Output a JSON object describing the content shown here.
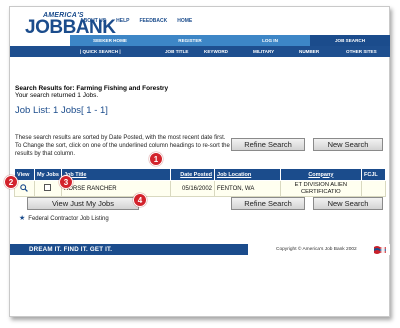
{
  "header": {
    "logo_small": "AMERICA'S",
    "logo_big": "JOBBANK",
    "top_nav": [
      "ABOUT US",
      "HELP",
      "FEEDBACK",
      "HOME"
    ]
  },
  "nav_primary": [
    "SEEKER HOME",
    "REGISTER",
    "LOG IN",
    "JOB SEARCH"
  ],
  "nav_secondary": [
    "| QUICK SEARCH |",
    "JOB TITLE",
    "KEYWORD",
    "MILITARY",
    "NUMBER",
    "OTHER SITES"
  ],
  "results": {
    "title": "Search Results for: Farming Fishing and Forestry",
    "subtitle": "Your search returned 1 Jobs.",
    "job_list": "Job List: 1 Jobs[ 1 - 1]"
  },
  "help_text": "These search results are sorted by Date Posted, with the most recent date first. To Change the sort, click on one of the underlined column headings to re-sort the results by that column.",
  "buttons": {
    "refine": "Refine Search",
    "new": "New Search",
    "view_my_jobs": "View Just My Jobs"
  },
  "table": {
    "headers": [
      "View",
      "My Jobs",
      "Job Title",
      "Date Posted",
      "Job Location",
      "Company",
      "FCJL"
    ],
    "rows": [
      {
        "job_title": "HORSE RANCHER",
        "date_posted": "05/16/2002",
        "location": "FENTON, WA",
        "company": "ET DIVISION ALIEN CERTIFICATIO"
      }
    ]
  },
  "callouts": [
    "1",
    "2",
    "3",
    "4"
  ],
  "federal_note": "Federal Contractor Job Listing",
  "footer": {
    "slogan": "DREAM IT. FIND IT. GET IT.",
    "copyright": "Copyright © America's Job Bank 2002"
  },
  "colors": {
    "brand_blue": "#1b4c8c",
    "nav_light_blue": "#3d86c6",
    "callout_red": "#d3232c"
  }
}
